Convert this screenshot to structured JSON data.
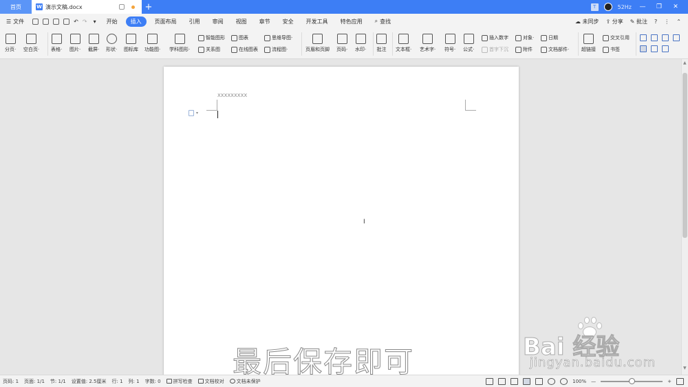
{
  "titlebar": {
    "home_tab": "首页",
    "doc_icon": "W",
    "doc_tab": "演示文稿.docx",
    "new_tab": "+",
    "badge": "T",
    "hz": "52Hz",
    "min": "—",
    "restore": "❐",
    "close": "✕"
  },
  "menu": {
    "file": "文件",
    "items": [
      "开始",
      "插入",
      "页面布局",
      "引用",
      "审阅",
      "视图",
      "章节",
      "安全",
      "开发工具",
      "特色应用"
    ],
    "search": "查找",
    "sync": "未同步",
    "share": "分享",
    "comment": "批注",
    "help": "?",
    "more": "⋮",
    "collapse": "⌃"
  },
  "ribbon": {
    "page_break": "分页·",
    "blank_page": "空白页·",
    "table": "表格·",
    "picture": "图片·",
    "screenshot": "截屏·",
    "shape": "形状·",
    "icon_lib": "图标库",
    "func_chart": "功能图·",
    "sci_shape": "学科图形·",
    "smart_shape": "智能图形",
    "chart": "图表",
    "mindmap": "思维导图·",
    "relation": "关系图",
    "online_chart": "在线图表",
    "flowchart": "流程图·",
    "header_footer": "页眉和页脚",
    "page_num": "页码·",
    "watermark": "水印·",
    "annotation": "批注",
    "textbox": "文本框·",
    "wordart": "艺术字·",
    "symbol": "符号·",
    "formula": "公式·",
    "insert_number": "插入数字",
    "dropcap": "首字下沉",
    "object": "对象·",
    "attachment": "附件",
    "date": "日期",
    "doc_part": "文档部件·",
    "hyperlink": "超链接",
    "cross_ref": "交叉引用",
    "bookmark": "书签"
  },
  "document": {
    "header_text": "XXXXXXXXX",
    "para_arrow": "▾",
    "ibeam": "I"
  },
  "overlay_text": "最后保存即可",
  "watermark": {
    "main": "Bai  经验",
    "sub": "jingyan.baidu.com"
  },
  "status": {
    "page_num": "页码: 1",
    "pages": "页面: 1/1",
    "section": "节: 1/1",
    "position": "设置值: 2.5厘米",
    "row": "行: 1",
    "col": "列: 1",
    "words": "字数: 0",
    "spellcheck": "拼写检查",
    "proofread": "文档校对",
    "protect": "文档未保护",
    "zoom": "100%",
    "zoom_minus": "—",
    "zoom_plus": "+",
    "zoom_level": 0.5
  },
  "scroll": {
    "up": "▲",
    "down": "▼"
  }
}
